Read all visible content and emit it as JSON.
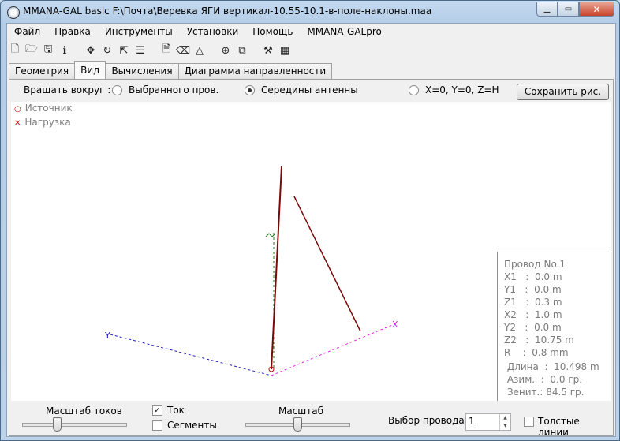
{
  "window": {
    "title": "MMANA-GAL basic F:\\Почта\\Веревка ЯГИ вертикал-10.55-10.1-в-поле-наклоны.maa"
  },
  "menu": [
    "Файл",
    "Правка",
    "Инструменты",
    "Установки",
    "Помощь",
    "MMANA-GALpro"
  ],
  "toolbar_icons": [
    "new-file-icon",
    "open-folder-icon",
    "save-icon",
    "info-icon",
    "move-icon",
    "rotate-icon",
    "scale-icon",
    "sliders-icon",
    "document-icon",
    "eraser-icon",
    "triangle-icon",
    "target-icon",
    "copy-icon",
    "tools-icon",
    "calculator-icon"
  ],
  "tabs": [
    "Геометрия",
    "Вид",
    "Вычисления",
    "Диаграмма направленности"
  ],
  "active_tab": "Вид",
  "rotate": {
    "label": "Вращать вокруг :",
    "options": [
      "Выбранного пров.",
      "Середины антенны",
      "X=0, Y=0, Z=H"
    ],
    "selected": "Середины антенны"
  },
  "save_button": "Сохранить рис.",
  "legend": {
    "source": "Источник",
    "load": "Нагрузка"
  },
  "axes": {
    "x": "X",
    "y": "Y"
  },
  "info": {
    "title": "Провод No.1",
    "lines": [
      "X1   :  0.0 m",
      "Y1   :  0.0 m",
      "Z1   :  0.3 m",
      "X2   :  1.0 m",
      "Y2   :  0.0 m",
      "Z2   :  10.75 m",
      "R    :  0.8 mm"
    ],
    "length": " Длина  :  10.498 m",
    "azimuth": " Азим.  :  0.0 гр.",
    "zenith": " Зенит.: 84.5 гр."
  },
  "bottom": {
    "current_scale": "Масштаб токов",
    "current": "Ток",
    "current_checked": true,
    "segments": "Сегменты",
    "segments_checked": false,
    "scale": "Масштаб",
    "wire_select": "Выбор провода",
    "wire_value": "1",
    "thick_lines": "Толстые линии",
    "thick_checked": false
  },
  "colors": {
    "wire": "#7a0a0a",
    "y_axis": "#2020c0",
    "x_axis": "#e020e0",
    "z_axis": "#208020",
    "source": "#cc0000"
  }
}
